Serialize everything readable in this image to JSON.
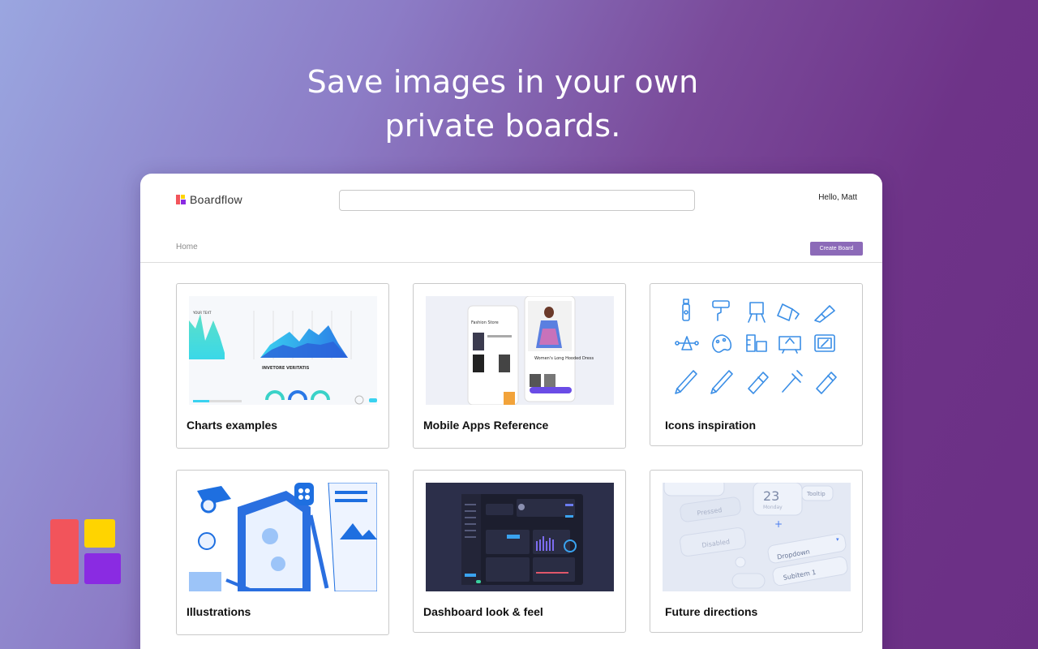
{
  "headline": {
    "line1": "Save images in your own",
    "line2": "private boards."
  },
  "app": {
    "brand_name": "Boardflow",
    "greeting": "Hello, Matt",
    "search": {
      "placeholder": "",
      "value": ""
    },
    "breadcrumb": "Home",
    "create_board_label": "Create Board"
  },
  "boards": [
    {
      "title": "Charts examples",
      "thumb_icon": "chart-thumbnail"
    },
    {
      "title": "Mobile Apps Reference",
      "thumb_icon": "mobile-app-thumbnail"
    },
    {
      "title": "Icons inspiration",
      "thumb_icon": "icons-grid-thumbnail"
    },
    {
      "title": "Illustrations",
      "thumb_icon": "isometric-illustration-thumbnail"
    },
    {
      "title": "Dashboard look & feel",
      "thumb_icon": "dark-dashboard-thumbnail"
    },
    {
      "title": "Future directions",
      "thumb_icon": "neumorphic-ui-thumbnail"
    }
  ],
  "thumb_text": {
    "charts_caption": "INVETORE VERITATIS",
    "mobile_store": "Fashion Store",
    "mobile_product": "Women's Long Hooded Dress",
    "future_date": "23",
    "future_day": "Monday",
    "future_pressed": "Pressed",
    "future_disabled": "Disabled",
    "future_tooltip": "Tooltip",
    "future_dropdown": "Dropdown",
    "future_subitem": "Subitem 1"
  },
  "colors": {
    "accent": "#8c6ab8",
    "brand_red": "#f2545b",
    "brand_yellow": "#ffd400",
    "brand_purple": "#8a2be2",
    "icon_blue": "#3a8ee6",
    "illustration_blue": "#1e6fe0",
    "dashboard_bg": "#2c2f4a"
  }
}
